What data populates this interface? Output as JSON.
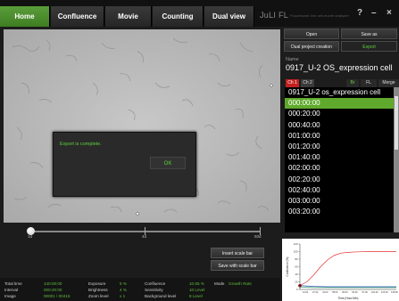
{
  "tabs": [
    {
      "label": "Home",
      "active": true
    },
    {
      "label": "Confluence",
      "active": false
    },
    {
      "label": "Movie",
      "active": false
    },
    {
      "label": "Counting",
      "active": false
    },
    {
      "label": "Dual view",
      "active": false
    }
  ],
  "logo": {
    "brand": "JuLI FL",
    "tagline": "Fluorescent live cell movie analyzer"
  },
  "window": {
    "help": "?",
    "minimize": "–",
    "close": "×"
  },
  "dialog": {
    "message": "Export is complete.",
    "ok": "OK"
  },
  "slider": {
    "min": "1d",
    "mid": "4d",
    "max": "50d",
    "position": 0.0
  },
  "buttons": {
    "insert_scale_bar": "Insert scale bar",
    "save_with_scale_bar": "Save with scale bar"
  },
  "info": {
    "total_time_label": "Total time",
    "total_time": "140:00:00",
    "interval_label": "Interval",
    "interval": "000:20:00",
    "image_label": "Image",
    "image": "00001 / 00415",
    "exposure_label": "Exposure",
    "exposure": "5 %",
    "brightness_label": "Brightness",
    "brightness": "4 %",
    "zoom_label": "Zoom level",
    "zoom": "x 1",
    "confluence_label": "Confluence",
    "confluence": "10.65 %",
    "sensitivity_label": "Sensitivity",
    "sensitivity": "10 Level",
    "background_label": "Background level",
    "background": "8 Level",
    "mode_label": "Mode",
    "mode": "Growth Rate"
  },
  "right": {
    "open": "Open",
    "save_as": "Save as",
    "dual_project": "Dual project creation",
    "export": "Export",
    "name_label": "Name",
    "name_value": "0917_U-2 OS_expression cell",
    "channels": {
      "ch1": "Ch 1",
      "ch2": "Ch 2",
      "br": "Br",
      "fl": "FL",
      "merge": "Merge"
    },
    "list_header": "0917_U-2 os_expression cell",
    "timepoints": [
      "000:00:00",
      "000:20:00",
      "000:40:00",
      "001:00:00",
      "001:20:00",
      "001:40:00",
      "002:00:00",
      "002:20:00",
      "002:40:00",
      "003:00:00",
      "003:20:00"
    ],
    "selected_index": 0
  },
  "chart_data": {
    "type": "line",
    "title": "",
    "xlabel": "Time (Hour:Min)",
    "ylabel": "Confluence (%)",
    "ylim": [
      0,
      120
    ],
    "yticks": [
      0,
      20,
      40,
      60,
      80,
      100,
      120
    ],
    "xticks": [
      "13:20",
      "27:20",
      "41:00",
      "55:00",
      "69:00",
      "83:00",
      "97:00",
      "110:20",
      "124:00",
      "138:00"
    ],
    "grid": false,
    "series": [
      {
        "color": "#e03030",
        "x": [
          0,
          10,
          20,
          30,
          40,
          50,
          60,
          70,
          80,
          90,
          100,
          110,
          120,
          130,
          140
        ],
        "values": [
          10,
          20,
          38,
          60,
          78,
          90,
          96,
          98,
          99,
          99.5,
          100,
          100,
          100,
          100,
          100
        ]
      },
      {
        "color": "#3050c0",
        "x": [
          0,
          20,
          40,
          60,
          80,
          100,
          120,
          140
        ],
        "values": [
          10,
          8,
          7,
          7,
          7,
          7,
          7,
          7
        ]
      },
      {
        "color": "#30a060",
        "x": [
          0,
          20,
          40,
          60,
          80,
          100,
          120,
          140
        ],
        "values": [
          6,
          5,
          5,
          5,
          5,
          5,
          5,
          5
        ]
      }
    ],
    "marker": {
      "x": 0,
      "y": 10
    }
  },
  "colors": {
    "accent": "#5fd13d",
    "selected": "#5faa2c",
    "ch1": "#c32020"
  }
}
